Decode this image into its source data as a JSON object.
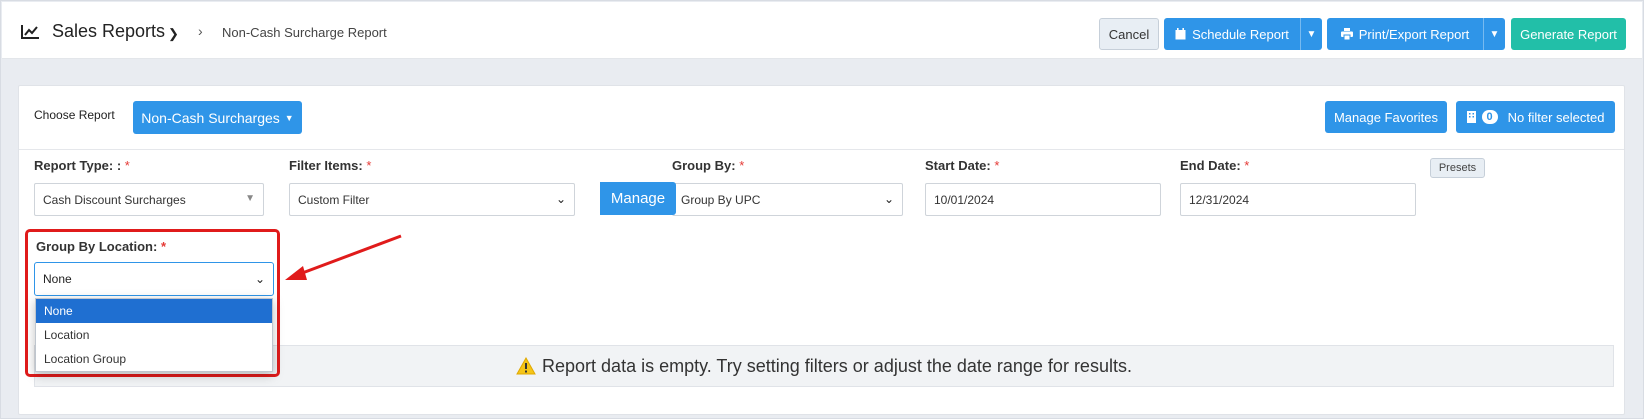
{
  "header": {
    "title": "Sales Reports",
    "breadcrumb_page": "Non-Cash Surcharge Report",
    "buttons": {
      "cancel": "Cancel",
      "schedule": "Schedule Report",
      "print_export": "Print/Export Report",
      "generate": "Generate Report"
    }
  },
  "report_bar": {
    "choose_label": "Choose Report",
    "selected_report": "Non-Cash Surcharges",
    "manage_favorites": "Manage Favorites",
    "filter_count": "0",
    "filter_text": "No filter selected"
  },
  "form": {
    "report_type": {
      "label": "Report Type: :",
      "value": "Cash Discount Surcharges"
    },
    "filter_items": {
      "label": "Filter Items:",
      "value": "Custom Filter",
      "manage": "Manage"
    },
    "group_by": {
      "label": "Group By:",
      "value": "Group By UPC"
    },
    "start_date": {
      "label": "Start Date:",
      "value": "10/01/2024"
    },
    "end_date": {
      "label": "End Date:",
      "value": "12/31/2024"
    },
    "presets": "Presets",
    "group_by_location": {
      "label": "Group By Location:",
      "value": "None",
      "options": [
        "None",
        "Location",
        "Location Group"
      ]
    },
    "required_mark": "*"
  },
  "empty_message": "Report data is empty. Try setting filters or adjust the date range for results.",
  "colors": {
    "primary": "#2f95e8",
    "generate": "#22bfa8",
    "highlight": "#e01b1b",
    "selected_option": "#1f6fd1"
  },
  "icons": [
    "chart-line-icon",
    "chevron-down-icon",
    "chevron-right-icon",
    "calendar-icon",
    "printer-icon",
    "building-icon",
    "warning-icon",
    "arrow-annotation"
  ]
}
